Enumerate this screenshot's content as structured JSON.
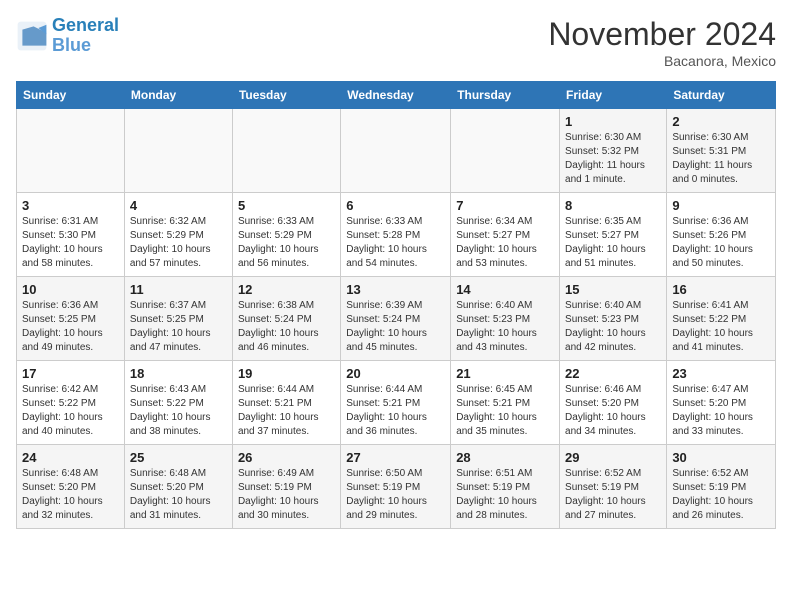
{
  "header": {
    "logo_line1": "General",
    "logo_line2": "Blue",
    "month": "November 2024",
    "location": "Bacanora, Mexico"
  },
  "weekdays": [
    "Sunday",
    "Monday",
    "Tuesday",
    "Wednesday",
    "Thursday",
    "Friday",
    "Saturday"
  ],
  "weeks": [
    [
      {
        "day": "",
        "info": ""
      },
      {
        "day": "",
        "info": ""
      },
      {
        "day": "",
        "info": ""
      },
      {
        "day": "",
        "info": ""
      },
      {
        "day": "",
        "info": ""
      },
      {
        "day": "1",
        "info": "Sunrise: 6:30 AM\nSunset: 5:32 PM\nDaylight: 11 hours\nand 1 minute."
      },
      {
        "day": "2",
        "info": "Sunrise: 6:30 AM\nSunset: 5:31 PM\nDaylight: 11 hours\nand 0 minutes."
      }
    ],
    [
      {
        "day": "3",
        "info": "Sunrise: 6:31 AM\nSunset: 5:30 PM\nDaylight: 10 hours\nand 58 minutes."
      },
      {
        "day": "4",
        "info": "Sunrise: 6:32 AM\nSunset: 5:29 PM\nDaylight: 10 hours\nand 57 minutes."
      },
      {
        "day": "5",
        "info": "Sunrise: 6:33 AM\nSunset: 5:29 PM\nDaylight: 10 hours\nand 56 minutes."
      },
      {
        "day": "6",
        "info": "Sunrise: 6:33 AM\nSunset: 5:28 PM\nDaylight: 10 hours\nand 54 minutes."
      },
      {
        "day": "7",
        "info": "Sunrise: 6:34 AM\nSunset: 5:27 PM\nDaylight: 10 hours\nand 53 minutes."
      },
      {
        "day": "8",
        "info": "Sunrise: 6:35 AM\nSunset: 5:27 PM\nDaylight: 10 hours\nand 51 minutes."
      },
      {
        "day": "9",
        "info": "Sunrise: 6:36 AM\nSunset: 5:26 PM\nDaylight: 10 hours\nand 50 minutes."
      }
    ],
    [
      {
        "day": "10",
        "info": "Sunrise: 6:36 AM\nSunset: 5:25 PM\nDaylight: 10 hours\nand 49 minutes."
      },
      {
        "day": "11",
        "info": "Sunrise: 6:37 AM\nSunset: 5:25 PM\nDaylight: 10 hours\nand 47 minutes."
      },
      {
        "day": "12",
        "info": "Sunrise: 6:38 AM\nSunset: 5:24 PM\nDaylight: 10 hours\nand 46 minutes."
      },
      {
        "day": "13",
        "info": "Sunrise: 6:39 AM\nSunset: 5:24 PM\nDaylight: 10 hours\nand 45 minutes."
      },
      {
        "day": "14",
        "info": "Sunrise: 6:40 AM\nSunset: 5:23 PM\nDaylight: 10 hours\nand 43 minutes."
      },
      {
        "day": "15",
        "info": "Sunrise: 6:40 AM\nSunset: 5:23 PM\nDaylight: 10 hours\nand 42 minutes."
      },
      {
        "day": "16",
        "info": "Sunrise: 6:41 AM\nSunset: 5:22 PM\nDaylight: 10 hours\nand 41 minutes."
      }
    ],
    [
      {
        "day": "17",
        "info": "Sunrise: 6:42 AM\nSunset: 5:22 PM\nDaylight: 10 hours\nand 40 minutes."
      },
      {
        "day": "18",
        "info": "Sunrise: 6:43 AM\nSunset: 5:22 PM\nDaylight: 10 hours\nand 38 minutes."
      },
      {
        "day": "19",
        "info": "Sunrise: 6:44 AM\nSunset: 5:21 PM\nDaylight: 10 hours\nand 37 minutes."
      },
      {
        "day": "20",
        "info": "Sunrise: 6:44 AM\nSunset: 5:21 PM\nDaylight: 10 hours\nand 36 minutes."
      },
      {
        "day": "21",
        "info": "Sunrise: 6:45 AM\nSunset: 5:21 PM\nDaylight: 10 hours\nand 35 minutes."
      },
      {
        "day": "22",
        "info": "Sunrise: 6:46 AM\nSunset: 5:20 PM\nDaylight: 10 hours\nand 34 minutes."
      },
      {
        "day": "23",
        "info": "Sunrise: 6:47 AM\nSunset: 5:20 PM\nDaylight: 10 hours\nand 33 minutes."
      }
    ],
    [
      {
        "day": "24",
        "info": "Sunrise: 6:48 AM\nSunset: 5:20 PM\nDaylight: 10 hours\nand 32 minutes."
      },
      {
        "day": "25",
        "info": "Sunrise: 6:48 AM\nSunset: 5:20 PM\nDaylight: 10 hours\nand 31 minutes."
      },
      {
        "day": "26",
        "info": "Sunrise: 6:49 AM\nSunset: 5:19 PM\nDaylight: 10 hours\nand 30 minutes."
      },
      {
        "day": "27",
        "info": "Sunrise: 6:50 AM\nSunset: 5:19 PM\nDaylight: 10 hours\nand 29 minutes."
      },
      {
        "day": "28",
        "info": "Sunrise: 6:51 AM\nSunset: 5:19 PM\nDaylight: 10 hours\nand 28 minutes."
      },
      {
        "day": "29",
        "info": "Sunrise: 6:52 AM\nSunset: 5:19 PM\nDaylight: 10 hours\nand 27 minutes."
      },
      {
        "day": "30",
        "info": "Sunrise: 6:52 AM\nSunset: 5:19 PM\nDaylight: 10 hours\nand 26 minutes."
      }
    ]
  ]
}
